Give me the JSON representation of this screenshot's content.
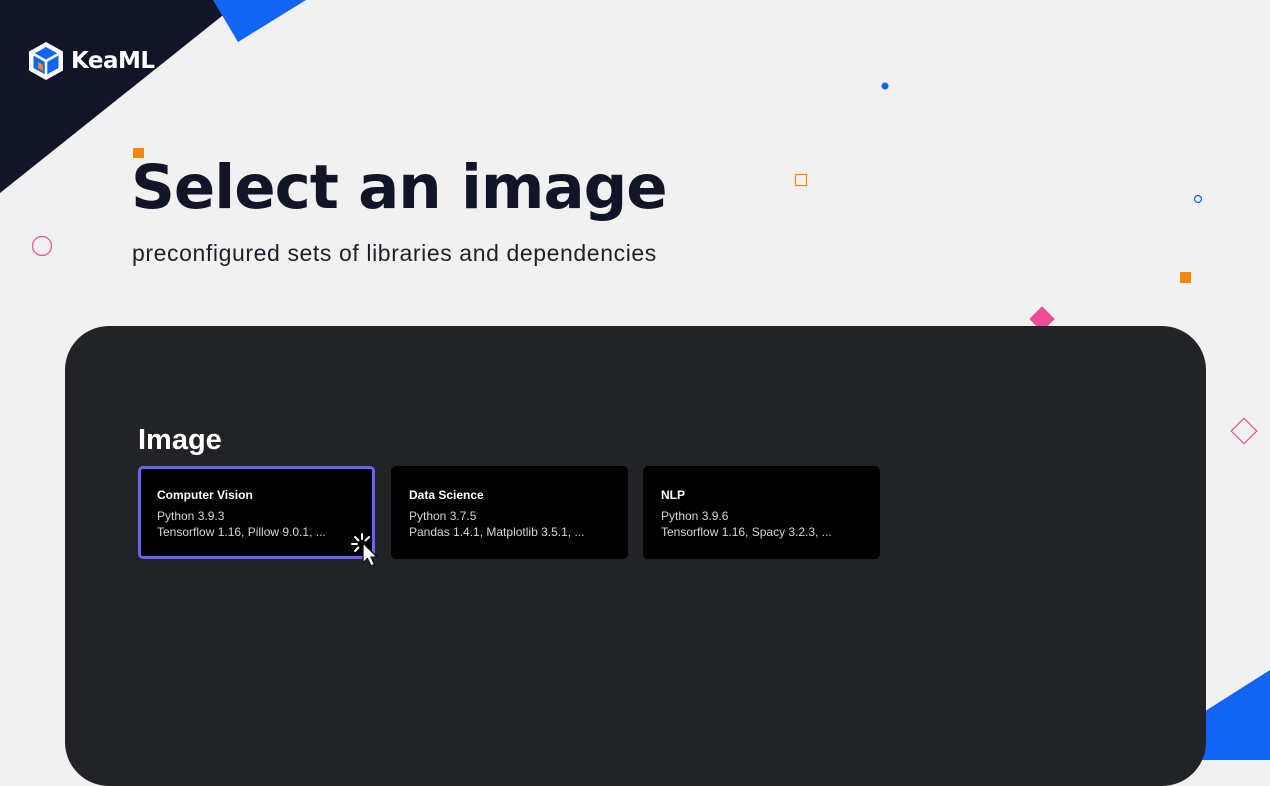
{
  "brand": {
    "name": "KeaML",
    "logo_icon": "hexagon-cube-icon"
  },
  "hero": {
    "title": "Select an image",
    "subtitle": "preconfigured sets of libraries and dependencies"
  },
  "panel": {
    "section_title": "Image",
    "cards": [
      {
        "title": "Computer Vision",
        "python": "Python 3.9.3",
        "libraries": "Tensorflow 1.16, Pillow 9.0.1, ...",
        "selected": true
      },
      {
        "title": "Data Science",
        "python": "Python 3.7.5",
        "libraries": "Pandas 1.4.1, Matplotlib 3.5.1, ...",
        "selected": false
      },
      {
        "title": "NLP",
        "python": "Python 3.9.6",
        "libraries": "Tensorflow 1.16, Spacy 3.2.3, ...",
        "selected": false
      }
    ]
  },
  "colors": {
    "page_background": "#f1f1f2",
    "navy": "#121528",
    "blue_accent": "#1264f4",
    "panel_background": "#222327",
    "card_background": "#000000",
    "selection_border": "#6a63ee",
    "orange": "#f5890f",
    "pink": "#ee4c95"
  }
}
